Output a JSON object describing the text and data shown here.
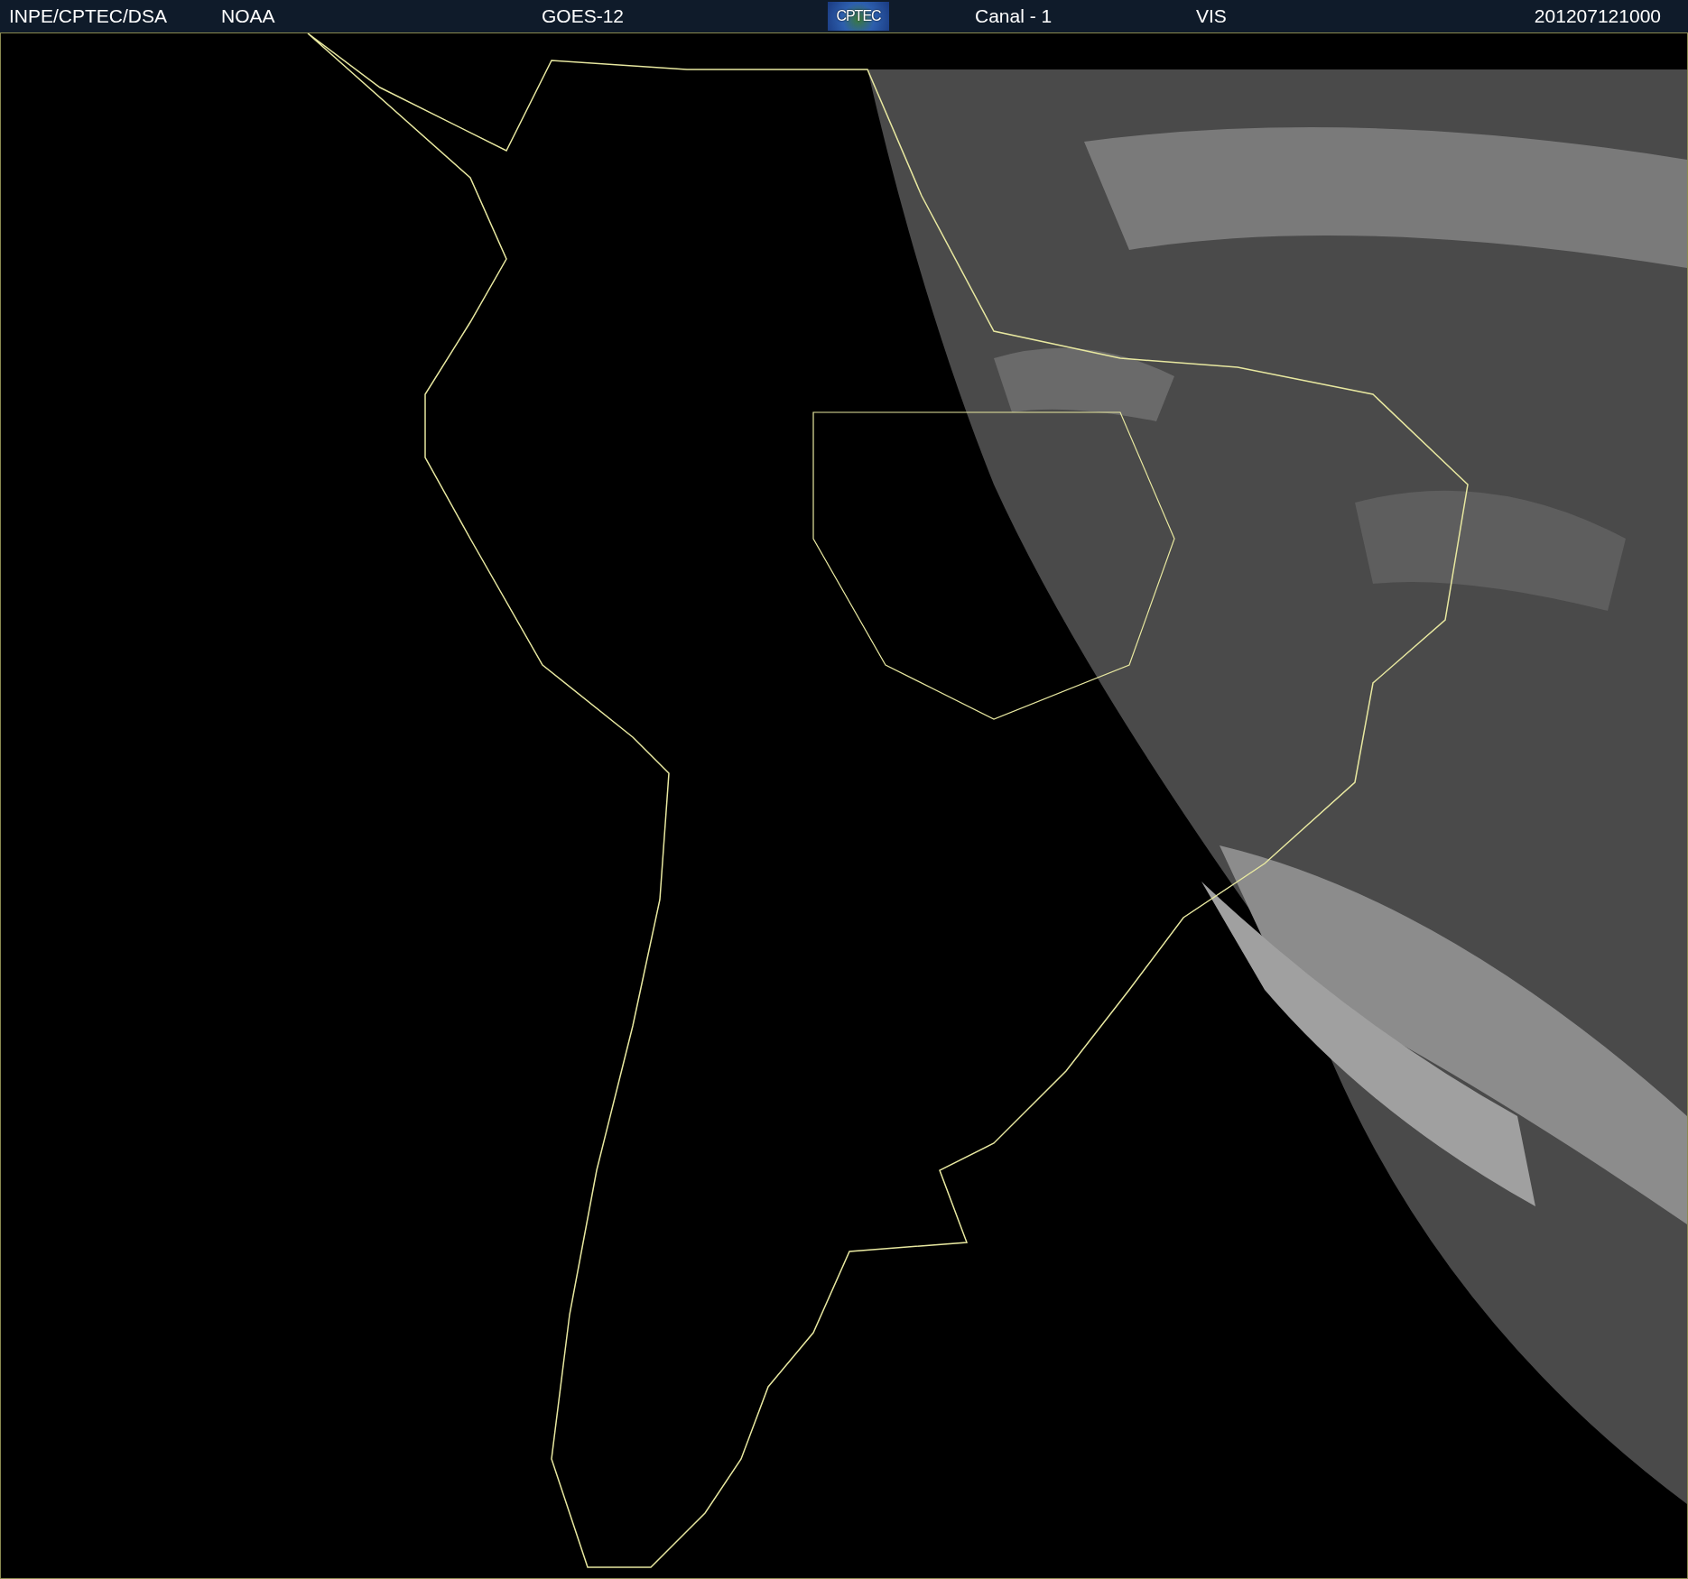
{
  "header": {
    "items": [
      {
        "kind": "text",
        "label": "INPE/CPTEC/DSA"
      },
      {
        "kind": "text",
        "label": "NOAA"
      },
      {
        "kind": "text",
        "label": "GOES-12"
      },
      {
        "kind": "logo",
        "label": "CPTEC"
      },
      {
        "kind": "text",
        "label": "Canal - 1"
      },
      {
        "kind": "text",
        "label": "VIS"
      },
      {
        "kind": "text",
        "label": "201207121000"
      }
    ]
  }
}
